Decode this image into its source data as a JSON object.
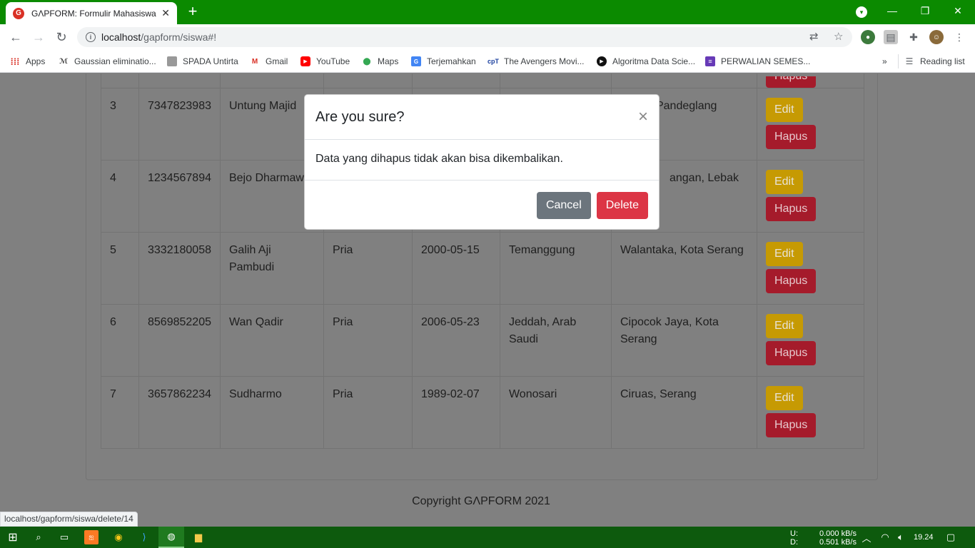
{
  "browser": {
    "tab_title": "GΛPFORM: Formulir Mahasiswa",
    "tab_favicon": "G",
    "url_host": "localhost",
    "url_path": "/gapform/siswa#!",
    "reading_list": "Reading list",
    "more_bookmarks": "»"
  },
  "bookmarks": [
    {
      "label": "Apps",
      "icon": "apps-grid-icon"
    },
    {
      "label": "Gaussian eliminatio...",
      "icon": "gaussian-icon"
    },
    {
      "label": "SPADA Untirta",
      "icon": "spada-icon"
    },
    {
      "label": "Gmail",
      "icon": "gmail-icon"
    },
    {
      "label": "YouTube",
      "icon": "youtube-icon"
    },
    {
      "label": "Maps",
      "icon": "maps-icon"
    },
    {
      "label": "Terjemahkan",
      "icon": "translate-icon"
    },
    {
      "label": "The Avengers Movi...",
      "icon": "avengers-icon"
    },
    {
      "label": "Algoritma Data Scie...",
      "icon": "algoritma-icon"
    },
    {
      "label": "PERWALIAN SEMES...",
      "icon": "forms-icon"
    }
  ],
  "table": {
    "top_partial_action": "Hapus",
    "rows": [
      {
        "no": "3",
        "nim": "7347823983",
        "nama": "Untung Majid",
        "jk": "",
        "tgl": "",
        "tempat": "",
        "alamat": "Pandeglang",
        "edit": "Edit",
        "hapus": "Hapus"
      },
      {
        "no": "4",
        "nim": "1234567894",
        "nama": "Bejo Dharmawa",
        "jk": "",
        "tgl": "",
        "tempat": "",
        "alamat": "angan, Lebak",
        "edit": "Edit",
        "hapus": "Hapus"
      },
      {
        "no": "5",
        "nim": "3332180058",
        "nama": "Galih Aji Pambudi",
        "jk": "Pria",
        "tgl": "2000-05-15",
        "tempat": "Temanggung",
        "alamat": "Walantaka, Kota Serang",
        "edit": "Edit",
        "hapus": "Hapus"
      },
      {
        "no": "6",
        "nim": "8569852205",
        "nama": "Wan Qadir",
        "jk": "Pria",
        "tgl": "2006-05-23",
        "tempat": "Jeddah, Arab Saudi",
        "alamat": "Cipocok Jaya, Kota Serang",
        "edit": "Edit",
        "hapus": "Hapus"
      },
      {
        "no": "7",
        "nim": "3657862234",
        "nama": "Sudharmo",
        "jk": "Pria",
        "tgl": "1989-02-07",
        "tempat": "Wonosari",
        "alamat": "Ciruas, Serang",
        "edit": "Edit",
        "hapus": "Hapus"
      }
    ]
  },
  "footer": "Copyright GΛPFORM 2021",
  "status_url": "localhost/gapform/siswa/delete/14",
  "modal": {
    "title": "Are you sure?",
    "close": "×",
    "body": "Data yang dihapus tidak akan bisa dikembalikan.",
    "cancel": "Cancel",
    "delete": "Delete"
  },
  "taskbar": {
    "net_up_label": "U:",
    "net_down_label": "D:",
    "net_up": "0.000 kB/s",
    "net_down": "0.501 kB/s",
    "time": "19.24"
  },
  "colors": {
    "titlebar": "#0b8a00",
    "overlay": "#808080",
    "delete": "#dc3545",
    "cancel": "#6c757d"
  }
}
